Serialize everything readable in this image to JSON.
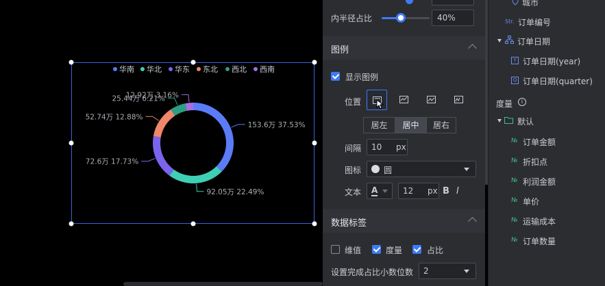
{
  "chart_data": {
    "type": "pie",
    "subtype": "donut",
    "legend_position": "top-center",
    "categories": [
      "华南",
      "华北",
      "华东",
      "东北",
      "西北",
      "西南"
    ],
    "colors": [
      "#5b7cf7",
      "#3ecfb5",
      "#7a64ee",
      "#f0866b",
      "#2c9e86",
      "#a66ee0"
    ],
    "values": [
      153.6,
      92.05,
      72.6,
      52.74,
      25.44,
      12.92
    ],
    "percents": [
      37.53,
      22.49,
      17.73,
      12.88,
      6.21,
      3.16
    ],
    "labels": [
      "153.6万 37.53%",
      "92.05万 22.49%",
      "72.6万 17.73%",
      "52.74万 12.88%",
      "25.44万 6.21%",
      "12.92万 3.16%"
    ]
  },
  "settings": {
    "inner_radius": {
      "label": "内半径占比",
      "value": "40%",
      "fraction": 0.4
    },
    "legend_section": {
      "title": "图例"
    },
    "show_legend": {
      "label": "显示图例",
      "checked": true
    },
    "position": {
      "label": "位置"
    },
    "align": {
      "left": "居左",
      "center": "居中",
      "right": "居右",
      "selected": "居中"
    },
    "spacing": {
      "label": "间隔",
      "value": "10",
      "unit": "px"
    },
    "icon": {
      "label": "图标",
      "value": "圆"
    },
    "text": {
      "label": "文本",
      "color_glyph": "A",
      "size": "12",
      "unit": "px",
      "bold": "B",
      "italic": "I"
    },
    "data_label_section": {
      "title": "数据标签"
    },
    "data_label_opts": [
      {
        "label": "维值",
        "checked": false
      },
      {
        "label": "度量",
        "checked": true
      },
      {
        "label": "占比",
        "checked": true
      }
    ],
    "decimals": {
      "label": "设置完成占比小数位数",
      "value": "2"
    }
  },
  "fields": {
    "city": "城市",
    "order_no": {
      "type": "Str.",
      "label": "订单编号"
    },
    "order_date": "订单日期",
    "order_date_year": {
      "type": "Y",
      "label": "订单日期(year)"
    },
    "order_date_quarter": {
      "type": "Q",
      "label": "订单日期(quarter)"
    },
    "measures_title": "度量",
    "default_folder": "默认",
    "measures": [
      "订单金额",
      "折扣点",
      "利润金额",
      "单价",
      "运输成本",
      "订单数量"
    ],
    "measure_type": "№"
  }
}
